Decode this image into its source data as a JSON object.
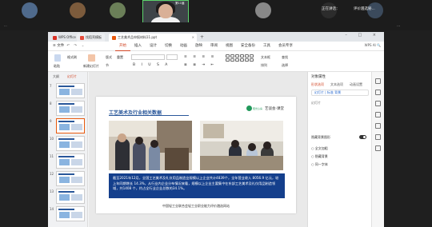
{
  "meeting": {
    "participants": [
      {
        "name": "",
        "avatar_color": "#4f6a8c"
      },
      {
        "name": "",
        "avatar_color": "#7c5b3c"
      },
      {
        "name": "",
        "avatar_color": "#6b7f58"
      },
      {
        "name": "",
        "avatar_color": "#888888"
      },
      {
        "name": "正在讲话：",
        "avatar_color": "#2c2c2c"
      },
      {
        "name": "评价遴选秘...",
        "avatar_color": "#3b4a5c"
      }
    ],
    "active_speaker_caption": "评价遴选秘书...",
    "active_speaker_name": "第11届",
    "left_label": "···",
    "right_label": "···"
  },
  "wps": {
    "tabs": [
      {
        "label": "WPS Office",
        "color": "#d93025"
      },
      {
        "label": "找稻壳模板",
        "color": "#e64c3c"
      },
      {
        "label": "工艺美术品申报材料11.ppt",
        "color": "#e8590c"
      }
    ],
    "menu_lead": "≡ 文件",
    "quick_icons": "↶ ↷ ⌄",
    "menus": [
      "开始",
      "插入",
      "设计",
      "切换",
      "动画",
      "放映",
      "审阅",
      "视图",
      "安全备份",
      "工具",
      "会员专享"
    ],
    "active_menu": "开始",
    "menu_right": "WPS AI  🔍",
    "ribbon": {
      "format_painter": "格式刷",
      "paste": "粘贴",
      "new_slide": "新建幻灯片",
      "layout": "版式",
      "section": "节",
      "reset": "重置",
      "font_name": "",
      "font_size": "",
      "format_buttons": "B I U S A",
      "align_buttons": "≡ ≡ ≡ ≡",
      "textbox": "文本框",
      "arrange": "排列",
      "find": "查找",
      "select": "选择"
    },
    "thumb_tabs": [
      "大纲",
      "幻灯片"
    ],
    "thumb_numbers": [
      "7",
      "8",
      "9",
      "10",
      "11",
      "12",
      "13",
      "14"
    ],
    "active_thumb": "9"
  },
  "slide": {
    "title": "工艺美术及行业相关数据",
    "logo_small": "阳光心房",
    "logo_text": "艺谈会·课堂",
    "body": "截至2021年12月，全国工艺美术及礼仪用品制造业规模以上企业共计4839个，全年营业收入 8056.9 亿元，较上年同期增长 14.3%，从行业内企业分布情况来看，规模以上企业主要集中在东部工艺美术及礼仪用品制造领域，共1408 个，约占全行业企业总数的34.1%。",
    "footer": "中国轻工业联合会轻工业职业能力评价遴选网站"
  },
  "props": {
    "title": "对象属性",
    "tabs": [
      "形状选项",
      "文本选项",
      "动画设置"
    ],
    "selected_item": "幻灯片 | 标准 背景",
    "row_1": "幻灯片",
    "toggle_label": "隐藏背景图形",
    "option_1": "○ 全文加粗",
    "option_2": "○ 隐藏背景",
    "option_3": "○ 同一字体"
  },
  "colors": {
    "accent": "#d24726",
    "slide_blue": "#143f8c",
    "logo_green": "#21995b"
  }
}
